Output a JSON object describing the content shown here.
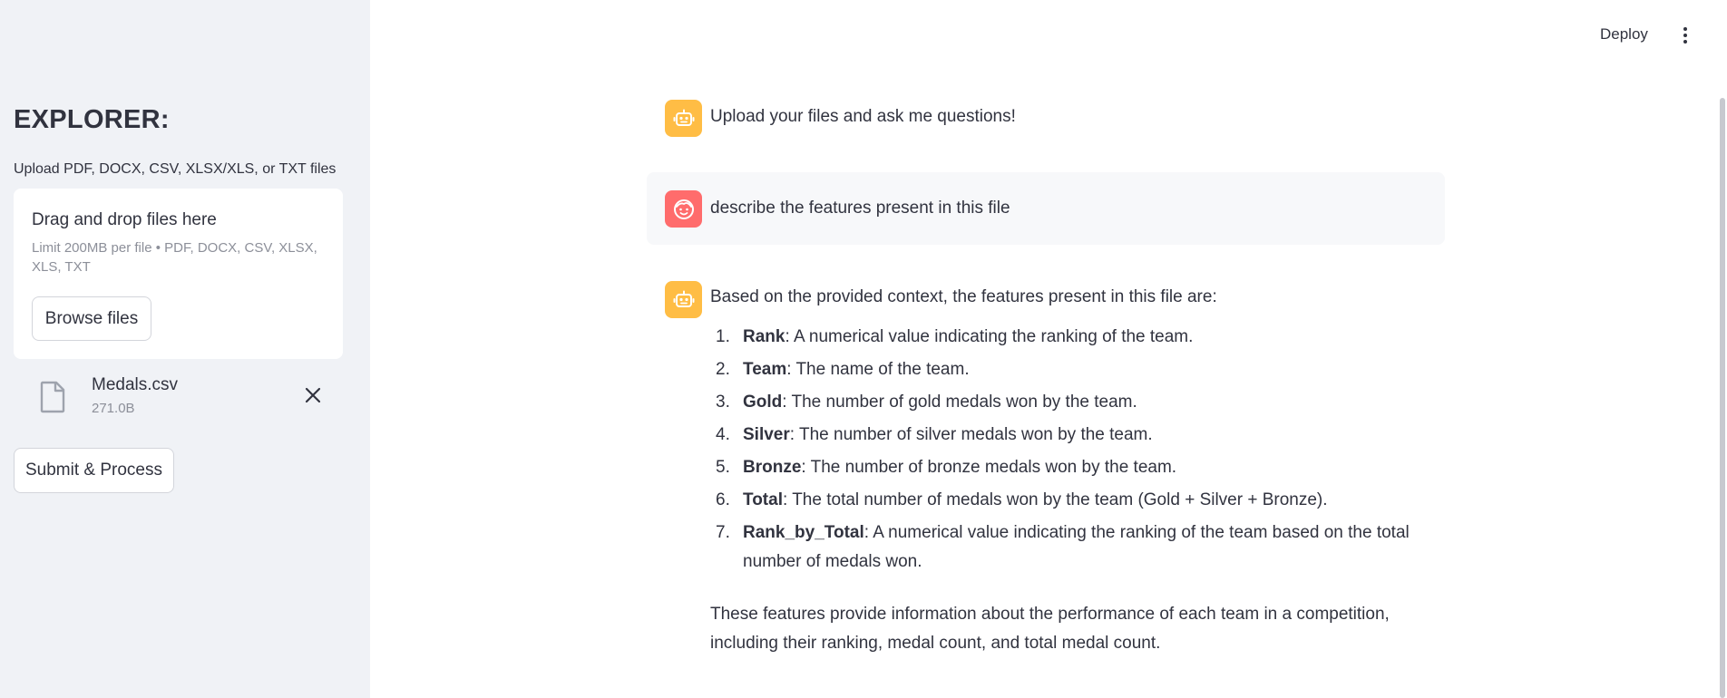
{
  "header": {
    "deploy_label": "Deploy"
  },
  "sidebar": {
    "title": "EXPLORER:",
    "uploader_label": "Upload PDF, DOCX, CSV, XLSX/XLS, or TXT files",
    "dropzone": {
      "title": "Drag and drop files here",
      "limit_text": "Limit 200MB per file • PDF, DOCX, CSV, XLSX, XLS, TXT",
      "browse_label": "Browse files"
    },
    "uploaded_file": {
      "name": "Medals.csv",
      "size": "271.0B"
    },
    "submit_label": "Submit & Process"
  },
  "chat": {
    "messages": [
      {
        "role": "assistant",
        "avatar_icon": "robot-icon",
        "text": "Upload your files and ask me questions!"
      },
      {
        "role": "user",
        "avatar_icon": "smiley-face-icon",
        "text": "describe the features present in this file"
      },
      {
        "role": "assistant",
        "avatar_icon": "robot-icon",
        "intro": "Based on the provided context, the features present in this file are:",
        "features": [
          {
            "num": "1.",
            "name": "Rank",
            "desc": ": A numerical value indicating the ranking of the team."
          },
          {
            "num": "2.",
            "name": "Team",
            "desc": ": The name of the team."
          },
          {
            "num": "3.",
            "name": "Gold",
            "desc": ": The number of gold medals won by the team."
          },
          {
            "num": "4.",
            "name": "Silver",
            "desc": ": The number of silver medals won by the team."
          },
          {
            "num": "5.",
            "name": "Bronze",
            "desc": ": The number of bronze medals won by the team."
          },
          {
            "num": "6.",
            "name": "Total",
            "desc": ": The total number of medals won by the team (Gold + Silver + Bronze)."
          },
          {
            "num": "7.",
            "name": "Rank_by_Total",
            "desc": ": A numerical value indicating the ranking of the team based on the total number of medals won."
          }
        ],
        "conclusion": "These features provide information about the performance of each team in a competition, including their ranking, medal count, and total medal count."
      }
    ]
  },
  "colors": {
    "sidebar_bg": "#f0f2f6",
    "bot_avatar": "#ffbd45",
    "user_avatar": "#ff6c6c",
    "text": "#31333f",
    "muted": "#8c8f99"
  }
}
